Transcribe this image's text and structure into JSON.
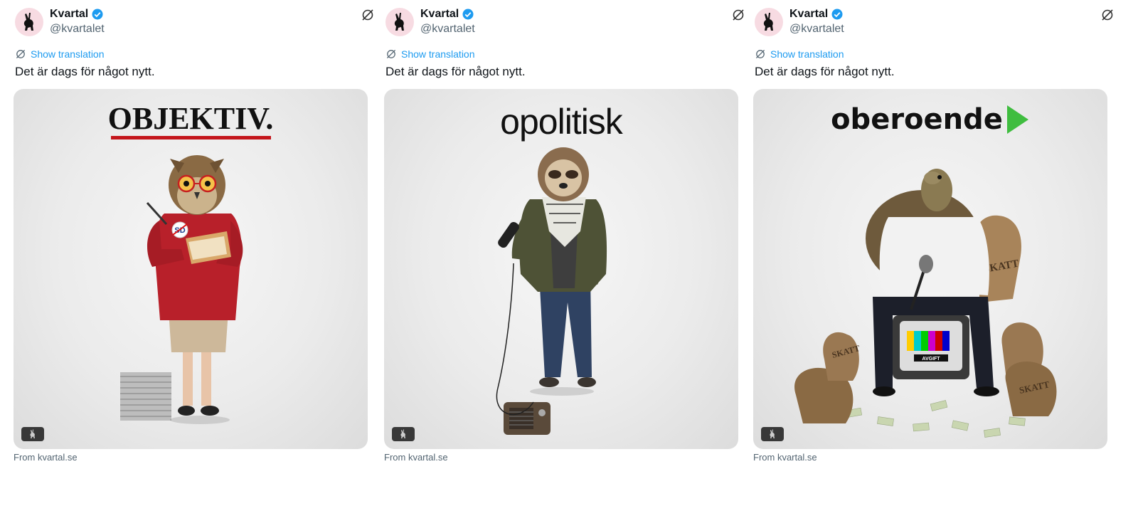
{
  "tweets": [
    {
      "name": "Kvartal",
      "handle": "@kvartalet",
      "translate_label": "Show translation",
      "text": "Det är dags för något nytt.",
      "card": {
        "headline": "OBJEKTIV.",
        "source": "From kvartal.se",
        "figure": "owl-figure",
        "badge_text": "SD"
      }
    },
    {
      "name": "Kvartal",
      "handle": "@kvartalet",
      "translate_label": "Show translation",
      "text": "Det är dags för något nytt.",
      "card": {
        "headline": "opolitisk",
        "source": "From kvartal.se",
        "figure": "sloth-figure"
      }
    },
    {
      "name": "Kvartal",
      "handle": "@kvartalet",
      "translate_label": "Show translation",
      "text": "Det är dags för något nytt.",
      "card": {
        "headline": "oberoende",
        "source": "From kvartal.se",
        "figure": "turtle-figure",
        "sack_label": "SKATT",
        "tv_label": "AVGIFT"
      }
    }
  ],
  "colors": {
    "link": "#1d9bf0",
    "verified": "#1d9bf0",
    "secondary_text": "#536471",
    "avatar_bg": "#f7dbe2",
    "objektiv_underline": "#c4161c",
    "oberoende_arrow": "#3fbd3f"
  },
  "icons": [
    "hare-icon",
    "verified-badge-icon",
    "translate-icon",
    "no-sync-icon"
  ]
}
